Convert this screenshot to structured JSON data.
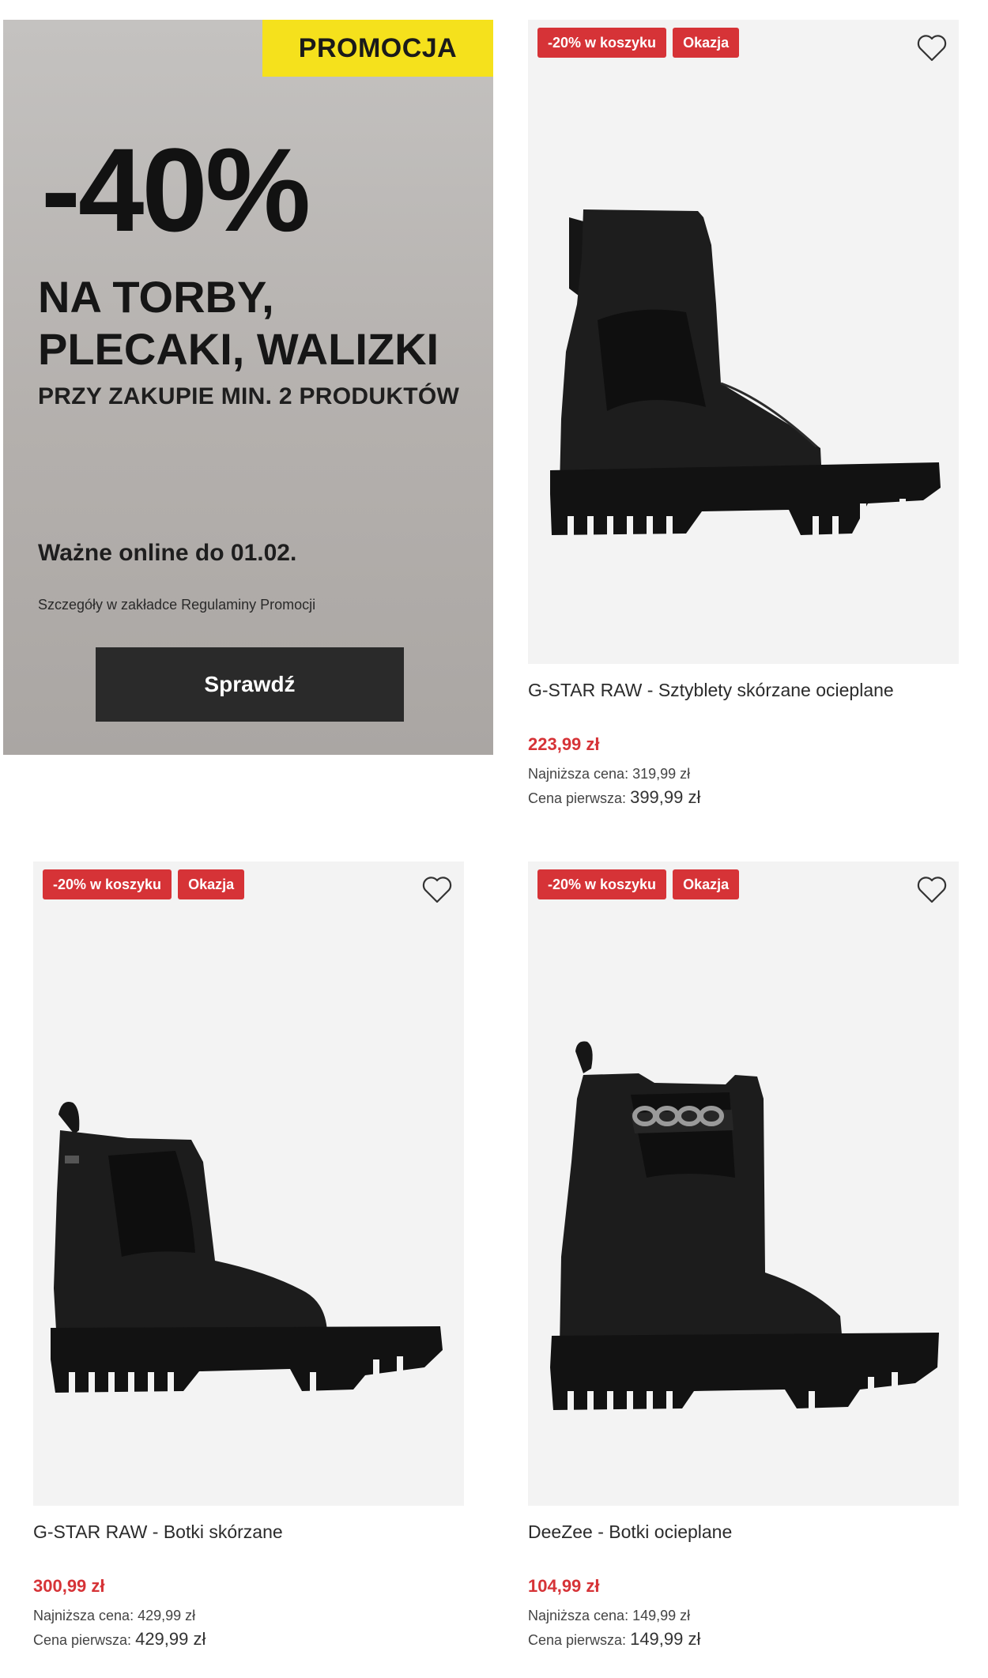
{
  "promo": {
    "tag": "PROMOCJA",
    "discount": "-40%",
    "headline_line1": "NA TORBY,",
    "headline_line2": "PLECAKI, WALIZKI",
    "condition": "PRZY ZAKUPIE MIN. 2 PRODUKTÓW",
    "valid_until": "Ważne online do 01.02.",
    "details": "Szczegóły w zakładce Regulaminy Promocji",
    "button_label": "Sprawdź",
    "colors": {
      "tag_bg": "#f5e11c",
      "button_bg": "#2a2a2a"
    }
  },
  "badge_color": "#d63337",
  "products": [
    {
      "badges": [
        "-20% w koszyku",
        "Okazja"
      ],
      "name": "G-STAR RAW - Sztyblety skórzane ocieplane",
      "price": "223,99 zł",
      "lowest_label": "Najniższa cena:",
      "lowest_value": "319,99 zł",
      "first_label": "Cena pierwsza:",
      "first_value": "399,99 zł",
      "image_icon": "black-ankle-boot-image",
      "wishlist_icon": "heart-icon"
    },
    {
      "badges": [
        "-20% w koszyku",
        "Okazja"
      ],
      "name": "G-STAR RAW - Botki skórzane",
      "price": "300,99 zł",
      "lowest_label": "Najniższa cena:",
      "lowest_value": "429,99 zł",
      "first_label": "Cena pierwsza:",
      "first_value": "429,99 zł",
      "image_icon": "black-chelsea-boot-image",
      "wishlist_icon": "heart-icon"
    },
    {
      "badges": [
        "-20% w koszyku",
        "Okazja"
      ],
      "name": "DeeZee - Botki ocieplane",
      "price": "104,99 zł",
      "lowest_label": "Najniższa cena:",
      "lowest_value": "149,99 zł",
      "first_label": "Cena pierwsza:",
      "first_value": "149,99 zł",
      "image_icon": "black-chain-chelsea-boot-image",
      "wishlist_icon": "heart-icon"
    }
  ]
}
